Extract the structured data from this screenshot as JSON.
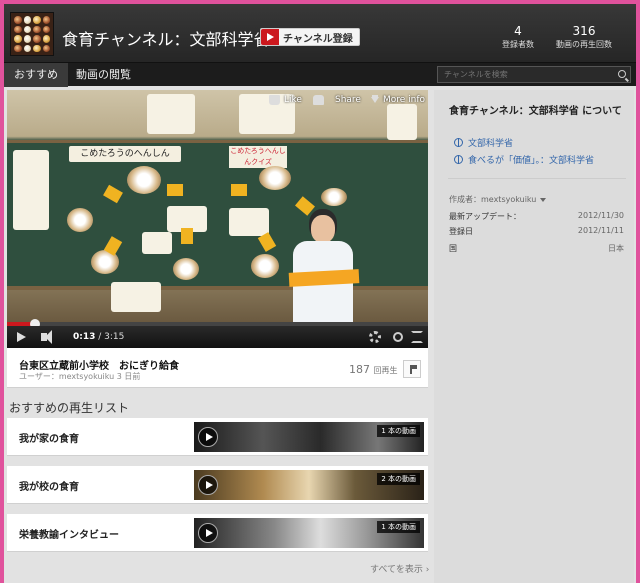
{
  "header": {
    "channel_title": "食育チャンネル：文部科学省",
    "subscribe_label": "チャンネル登録",
    "stats": [
      {
        "num": "4",
        "label": "登録者数"
      },
      {
        "num": "316",
        "label": "動画の再生回数"
      }
    ]
  },
  "nav": {
    "tabs": [
      "おすすめ",
      "動画の閲覧"
    ],
    "search_placeholder": "チャンネルを検索"
  },
  "player": {
    "like": "Like",
    "share": "Share",
    "more": "More info",
    "time_current": "0:13",
    "time_total": " / 3:15",
    "progress_fraction": 0.067,
    "board_title": "こめたろうのへんしん",
    "board_subtitle": "こめたろうへんしんクイズ",
    "accent_color": "#cc181e"
  },
  "video": {
    "title": "台東区立蔵前小学校　おにぎり給食",
    "meta": "ユーザー：mextsyokuiku 3 日前",
    "views": "187",
    "views_unit": "回再生"
  },
  "playlists": {
    "section_title": "おすすめの再生リスト",
    "items": [
      {
        "name": "我が家の食育",
        "count": "1 本の動画"
      },
      {
        "name": "我が校の食育",
        "count": "2 本の動画"
      },
      {
        "name": "栄養教諭インタビュー",
        "count": "1 本の動画"
      }
    ],
    "show_all": "すべてを表示 ›"
  },
  "about": {
    "title": "食育チャンネル：文部科学省 について",
    "links": [
      "文部科学省",
      "食べるが「価値」。：文部科学省"
    ],
    "author": "作成者：mextsyokuiku",
    "rows": [
      {
        "label": "最新アップデート：",
        "value": "2012/11/30"
      },
      {
        "label": "登録日",
        "value": "2012/11/11"
      },
      {
        "label": "国",
        "value": "日本"
      }
    ]
  }
}
